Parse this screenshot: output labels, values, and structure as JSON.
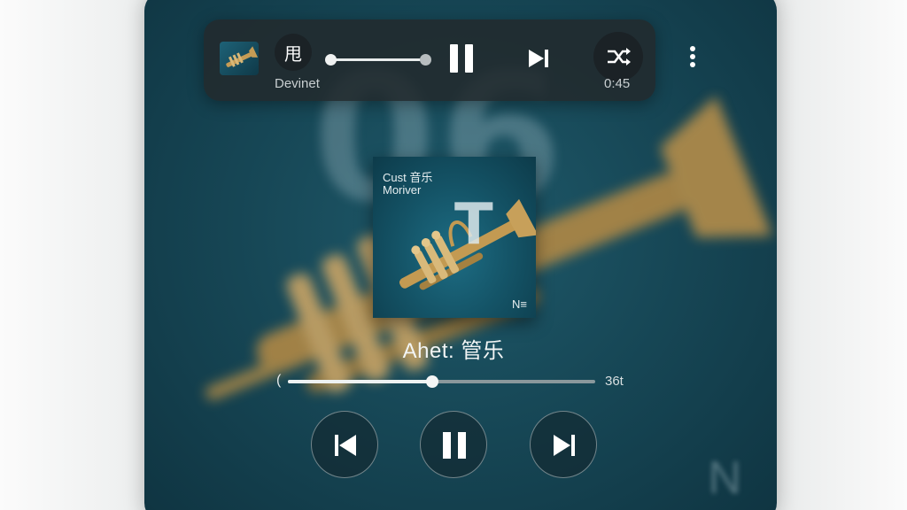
{
  "mini_player": {
    "glyph_button_label": "甩",
    "artist": "Devinet",
    "progress_fraction": 1.0,
    "time": "0:45"
  },
  "album": {
    "line1": "Cust 音乐",
    "line2": "Moriver",
    "big_letter": "T",
    "corner_mark": "N≡"
  },
  "track": {
    "title": "Ahet: 管乐"
  },
  "progress": {
    "start_label": "(",
    "fraction": 0.47,
    "end_label": "36t"
  },
  "background": {
    "big_text": "06",
    "corner_text": "N"
  },
  "icons": [
    "album-thumbnail-icon",
    "pause-icon",
    "skip-next-icon",
    "shuffle-icon",
    "more-vert-icon",
    "skip-previous-icon"
  ],
  "colors": {
    "panel_bg": "#1a4f5f",
    "mini_bar_bg": "#222a2e",
    "accent": "#eef2f2"
  }
}
